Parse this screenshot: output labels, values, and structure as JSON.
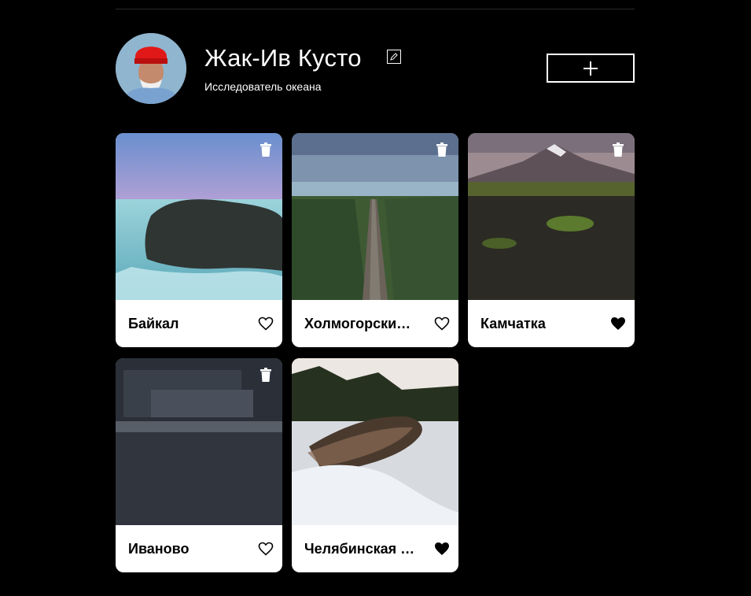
{
  "profile": {
    "name": "Жак-Ив Кусто",
    "about": "Исследователь океана",
    "avatar_icon": "person-portrait"
  },
  "buttons": {
    "edit_icon": "pencil-icon",
    "add_icon": "plus-icon"
  },
  "cards": [
    {
      "title": "Байкал",
      "liked": false,
      "scene": "frozen-lake-cliff"
    },
    {
      "title": "Холмогорски…",
      "liked": false,
      "scene": "railway-forest"
    },
    {
      "title": "Камчатка",
      "liked": true,
      "scene": "volcano-field"
    },
    {
      "title": "Иваново",
      "liked": false,
      "scene": "city-buildings"
    },
    {
      "title": "Челябинская …",
      "liked": true,
      "scene": "snowy-river"
    }
  ],
  "colors": {
    "background": "#000000",
    "card": "#ffffff",
    "text_dark": "#000000",
    "text_light": "#ffffff"
  }
}
